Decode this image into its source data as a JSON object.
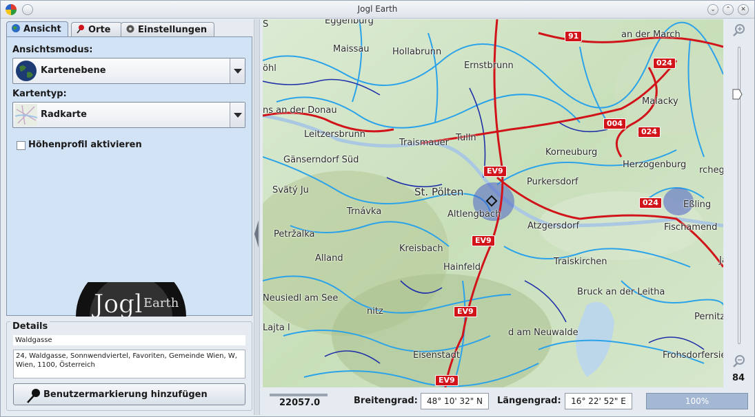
{
  "window": {
    "title": "Jogl Earth"
  },
  "tabs": [
    {
      "label": "Ansicht",
      "active": true
    },
    {
      "label": "Orte",
      "active": false
    },
    {
      "label": "Einstellungen",
      "active": false
    }
  ],
  "view": {
    "mode_label": "Ansichtsmodus:",
    "mode_value": "Kartenebene",
    "maptype_label": "Kartentyp:",
    "maptype_value": "Radkarte",
    "elevation_label": "Höhenprofil aktivieren",
    "elevation_checked": false
  },
  "logo": {
    "text_main": "Jogl",
    "text_sub": "Earth"
  },
  "details": {
    "title": "Details",
    "name": "Waldgasse",
    "address": "24, Waldgasse, Sonnwendviertel, Favoriten, Gemeinde Wien, W, Wien, 1100, Österreich",
    "add_button": "Benutzermarkierung hinzufügen"
  },
  "map": {
    "places": [
      "Eggenburg",
      "Maissau",
      "Hollabrunn",
      "an der March",
      "öhl",
      "Ernstbrunn",
      "Malacky",
      "ns an der Donau",
      "Leitzersbrunn",
      "Traismauer",
      "Tulln",
      "Korneuburg",
      "Gänserndorf Süd",
      "Herzogenburg",
      "rchegg",
      "Svätý Ju",
      "St. Pölten",
      "Purkersdorf",
      "Eßling",
      "Trnávka",
      "Altlengbach",
      "Atzgersdorf",
      "Fischamend",
      "Petržalka",
      "Kreisbach",
      "Alland",
      "Hainfeld",
      "Traiskirchen",
      "Bruck an der Leitha",
      "Neusiedl am See",
      "nitz",
      "Pernitz",
      "Lajta l",
      "d am Neuwalde",
      "Eisenstadt",
      "Frohsdorfersiedlung",
      "Jánossomorja",
      "S"
    ],
    "road_badges": [
      "91",
      "024",
      "004",
      "024",
      "EV9",
      "024",
      "EV9",
      "EV9",
      "EV9"
    ]
  },
  "zoom": {
    "level": "84",
    "in_icon": "zoom-in-icon",
    "out_icon": "zoom-out-icon"
  },
  "status": {
    "scale_value": "22057.0",
    "lat_label": "Breitengrad:",
    "lat_value": "48° 10' 32\" N",
    "lon_label": "Längengrad:",
    "lon_value": "16° 22' 52\" E",
    "progress": "100%"
  }
}
